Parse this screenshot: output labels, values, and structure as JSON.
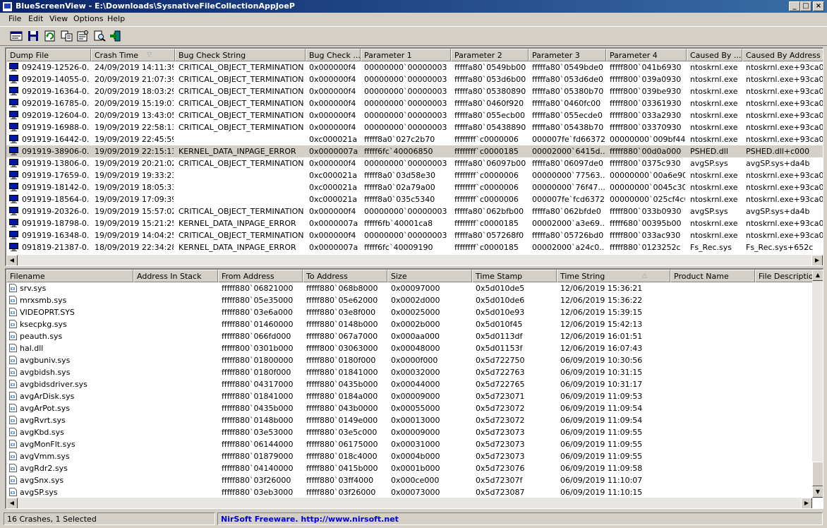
{
  "window": {
    "title": "BlueScreenView - E:\\Downloads\\SysnativeFileCollectionAppJoeP",
    "min_glyph": "_",
    "max_glyph": "□",
    "close_glyph": "×"
  },
  "menu": [
    "File",
    "Edit",
    "View",
    "Options",
    "Help"
  ],
  "toolbar": [
    "html-report-icon",
    "save-icon",
    "refresh-icon",
    "copy-icon",
    "properties-icon",
    "find-icon",
    "exit-icon"
  ],
  "crash_list": {
    "columns": [
      {
        "label": "Dump File",
        "w": 120
      },
      {
        "label": "Crash Time",
        "w": 119,
        "sorted": true
      },
      {
        "label": "Bug Check String",
        "w": 185
      },
      {
        "label": "Bug Check ...",
        "w": 78
      },
      {
        "label": "Parameter 1",
        "w": 128
      },
      {
        "label": "Parameter 2",
        "w": 110
      },
      {
        "label": "Parameter 3",
        "w": 110
      },
      {
        "label": "Parameter 4",
        "w": 114
      },
      {
        "label": "Caused By ...",
        "w": 79
      },
      {
        "label": "Caused By Address",
        "w": 120
      }
    ],
    "sort_glyph": "▽",
    "selected_index": 7,
    "rows": [
      [
        "092419-12526-0...",
        "24/09/2019 14:11:39",
        "CRITICAL_OBJECT_TERMINATION",
        "0x000000f4",
        "00000000`00000003",
        "fffffa80`0549bb00",
        "fffffa80`0549bde0",
        "fffff800`041b6930",
        "ntoskrnl.exe",
        "ntoskrnl.exe+93ca0"
      ],
      [
        "092019-14055-0...",
        "20/09/2019 21:07:39",
        "CRITICAL_OBJECT_TERMINATION",
        "0x000000f4",
        "00000000`00000003",
        "fffffa80`053d6b00",
        "fffffa80`053d6de0",
        "fffff800`039a0930",
        "ntoskrnl.exe",
        "ntoskrnl.exe+93ca0"
      ],
      [
        "092019-16364-0...",
        "20/09/2019 18:03:29",
        "CRITICAL_OBJECT_TERMINATION",
        "0x000000f4",
        "00000000`00000003",
        "fffffa80`05380890",
        "fffffa80`05380b70",
        "fffff800`039be930",
        "ntoskrnl.exe",
        "ntoskrnl.exe+93ca0"
      ],
      [
        "092019-16785-0...",
        "20/09/2019 15:19:01",
        "CRITICAL_OBJECT_TERMINATION",
        "0x000000f4",
        "00000000`00000003",
        "fffffa80`0460f920",
        "fffffa80`0460fc00",
        "fffff800`03361930",
        "ntoskrnl.exe",
        "ntoskrnl.exe+93ca0"
      ],
      [
        "092019-12604-0...",
        "20/09/2019 13:43:05",
        "CRITICAL_OBJECT_TERMINATION",
        "0x000000f4",
        "00000000`00000003",
        "fffffa80`055ecb00",
        "fffffa80`055ecde0",
        "fffff800`033a2930",
        "ntoskrnl.exe",
        "ntoskrnl.exe+93ca0"
      ],
      [
        "091919-16988-0...",
        "19/09/2019 22:58:13",
        "CRITICAL_OBJECT_TERMINATION",
        "0x000000f4",
        "00000000`00000003",
        "fffffa80`05438890",
        "fffffa80`05438b70",
        "fffff800`03370930",
        "ntoskrnl.exe",
        "ntoskrnl.exe+93ca0"
      ],
      [
        "091919-16442-0...",
        "19/09/2019 22:45:59",
        "",
        "0xc000021a",
        "fffff8a0`027c2b70",
        "ffffffff`c0000006",
        "000007fe`fd663720",
        "00000000`009bf440",
        "ntoskrnl.exe",
        "ntoskrnl.exe+93ca0"
      ],
      [
        "091919-38906-0...",
        "19/09/2019 22:15:13",
        "KERNEL_DATA_INPAGE_ERROR",
        "0x0000007a",
        "fffff6fc`40006850",
        "ffffffff`c0000185",
        "00002000`6415d...",
        "fffff880`00d0a000",
        "PSHED.dll",
        "PSHED.dll+c000"
      ],
      [
        "091919-13806-0...",
        "19/09/2019 20:21:02",
        "CRITICAL_OBJECT_TERMINATION",
        "0x000000f4",
        "00000000`00000003",
        "fffffa80`06097b00",
        "fffffa80`06097de0",
        "fffff800`0375c930",
        "avgSP.sys",
        "avgSP.sys+da4b"
      ],
      [
        "091919-17659-0...",
        "19/09/2019 19:33:23",
        "",
        "0xc000021a",
        "fffff8a0`03d58e30",
        "ffffffff`c0000006",
        "00000000`77563...",
        "00000000`00a6e900",
        "ntoskrnl.exe",
        "ntoskrnl.exe+93ca0"
      ],
      [
        "091919-18142-0...",
        "19/09/2019 18:05:33",
        "",
        "0xc000021a",
        "fffff8a0`02a79a00",
        "ffffffff`c0000006",
        "00000000`76f47...",
        "00000000`0045c300",
        "ntoskrnl.exe",
        "ntoskrnl.exe+93ca0"
      ],
      [
        "091919-18564-0...",
        "19/09/2019 17:09:39",
        "",
        "0xc000021a",
        "fffff8a0`035c5340",
        "ffffffff`c0000006",
        "000007fe`fcd63720",
        "00000000`025cf4c0",
        "ntoskrnl.exe",
        "ntoskrnl.exe+93ca0"
      ],
      [
        "091919-20326-0...",
        "19/09/2019 15:57:02",
        "CRITICAL_OBJECT_TERMINATION",
        "0x000000f4",
        "00000000`00000003",
        "fffffa80`062bfb00",
        "fffffa80`062bfde0",
        "fffff800`033b0930",
        "avgSP.sys",
        "avgSP.sys+da4b"
      ],
      [
        "091919-18798-0...",
        "19/09/2019 15:21:25",
        "KERNEL_DATA_INPAGE_ERROR",
        "0x0000007a",
        "fffff6fb`40001ca8",
        "ffffffff`c0000185",
        "00002000`a3e69...",
        "fffff680`00395b00",
        "ntoskrnl.exe",
        "ntoskrnl.exe+93ca0"
      ],
      [
        "091919-16348-0...",
        "19/09/2019 14:04:25",
        "CRITICAL_OBJECT_TERMINATION",
        "0x000000f4",
        "00000000`00000003",
        "fffffa80`057268f0",
        "fffffa80`05726bd0",
        "fffff800`033ac930",
        "ntoskrnl.exe",
        "ntoskrnl.exe+93ca0"
      ],
      [
        "091819-21387-0...",
        "18/09/2019 22:34:28",
        "KERNEL_DATA_INPAGE_ERROR",
        "0x0000007a",
        "fffff6fc`40009190",
        "ffffffff`c0000185",
        "00002000`a24c0...",
        "fffff880`0123252c",
        "Fs_Rec.sys",
        "Fs_Rec.sys+652c"
      ]
    ]
  },
  "driver_list": {
    "columns": [
      {
        "label": "Filename",
        "w": 180
      },
      {
        "label": "Address In Stack",
        "w": 120
      },
      {
        "label": "From Address",
        "w": 120
      },
      {
        "label": "To Address",
        "w": 120
      },
      {
        "label": "Size",
        "w": 120
      },
      {
        "label": "Time Stamp",
        "w": 120
      },
      {
        "label": "Time String",
        "w": 161,
        "sorted": true
      },
      {
        "label": "Product Name",
        "w": 120
      },
      {
        "label": "File Description",
        "w": 100
      }
    ],
    "sort_glyph": "△",
    "rows": [
      [
        "srv.sys",
        "",
        "fffff880`06821000",
        "fffff880`068b8000",
        "0x00097000",
        "0x5d010de5",
        "12/06/2019 15:36:21",
        "",
        ""
      ],
      [
        "mrxsmb.sys",
        "",
        "fffff880`05e35000",
        "fffff880`05e62000",
        "0x0002d000",
        "0x5d010de6",
        "12/06/2019 15:36:22",
        "",
        ""
      ],
      [
        "VIDEOPRT.SYS",
        "",
        "fffff880`03e6a000",
        "fffff880`03e8f000",
        "0x00025000",
        "0x5d010e93",
        "12/06/2019 15:39:15",
        "",
        ""
      ],
      [
        "ksecpkg.sys",
        "",
        "fffff880`01460000",
        "fffff880`0148b000",
        "0x0002b000",
        "0x5d010f45",
        "12/06/2019 15:42:13",
        "",
        ""
      ],
      [
        "peauth.sys",
        "",
        "fffff880`066fd000",
        "fffff880`067a7000",
        "0x000aa000",
        "0x5d0113df",
        "12/06/2019 16:01:51",
        "",
        ""
      ],
      [
        "hal.dll",
        "",
        "fffff800`0301b000",
        "fffff800`03063000",
        "0x00048000",
        "0x5d01153f",
        "12/06/2019 16:07:43",
        "",
        ""
      ],
      [
        "avgbuniv.sys",
        "",
        "fffff880`01800000",
        "fffff880`0180f000",
        "0x0000f000",
        "0x5d722750",
        "06/09/2019 10:30:56",
        "",
        ""
      ],
      [
        "avgbidsh.sys",
        "",
        "fffff880`0180f000",
        "fffff880`01841000",
        "0x00032000",
        "0x5d722763",
        "06/09/2019 10:31:15",
        "",
        ""
      ],
      [
        "avgbidsdriver.sys",
        "",
        "fffff880`04317000",
        "fffff880`0435b000",
        "0x00044000",
        "0x5d722765",
        "06/09/2019 10:31:17",
        "",
        ""
      ],
      [
        "avgArDisk.sys",
        "",
        "fffff880`01841000",
        "fffff880`0184a000",
        "0x00009000",
        "0x5d723071",
        "06/09/2019 11:09:53",
        "",
        ""
      ],
      [
        "avgArPot.sys",
        "",
        "fffff880`0435b000",
        "fffff880`043b0000",
        "0x00055000",
        "0x5d723072",
        "06/09/2019 11:09:54",
        "",
        ""
      ],
      [
        "avgRvrt.sys",
        "",
        "fffff880`0148b000",
        "fffff880`0149e000",
        "0x00013000",
        "0x5d723072",
        "06/09/2019 11:09:54",
        "",
        ""
      ],
      [
        "avgKbd.sys",
        "",
        "fffff880`03e53000",
        "fffff880`03e5c000",
        "0x00009000",
        "0x5d723073",
        "06/09/2019 11:09:55",
        "",
        ""
      ],
      [
        "avgMonFlt.sys",
        "",
        "fffff880`06144000",
        "fffff880`06175000",
        "0x00031000",
        "0x5d723073",
        "06/09/2019 11:09:55",
        "",
        ""
      ],
      [
        "avgVmm.sys",
        "",
        "fffff880`01879000",
        "fffff880`018c4000",
        "0x0004b000",
        "0x5d723073",
        "06/09/2019 11:09:55",
        "",
        ""
      ],
      [
        "avgRdr2.sys",
        "",
        "fffff880`04140000",
        "fffff880`0415b000",
        "0x0001b000",
        "0x5d723076",
        "06/09/2019 11:09:58",
        "",
        ""
      ],
      [
        "avgSnx.sys",
        "",
        "fffff880`03f26000",
        "fffff880`03ff4000",
        "0x000ce000",
        "0x5d72307f",
        "06/09/2019 11:10:07",
        "",
        ""
      ],
      [
        "avgSP.sys",
        "",
        "fffff880`03eb3000",
        "fffff880`03f26000",
        "0x00073000",
        "0x5d723087",
        "06/09/2019 11:10:15",
        "",
        ""
      ]
    ]
  },
  "scroll": {
    "up": "▲",
    "down": "▼",
    "left": "◀",
    "right": "▶"
  },
  "status": {
    "count": "16 Crashes, 1 Selected",
    "credit": "NirSoft Freeware.  http://www.nirsoft.net"
  }
}
